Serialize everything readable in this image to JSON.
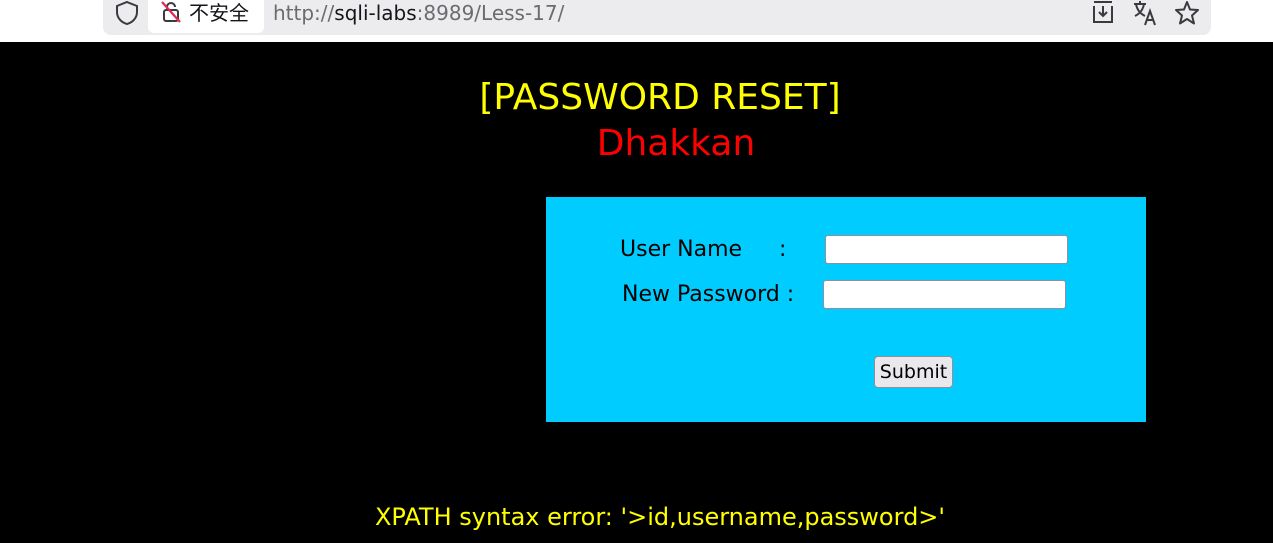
{
  "browser": {
    "security_label": "不安全",
    "url_scheme": "http://",
    "url_host": "sqli-labs",
    "url_rest": ":8989/Less-17/",
    "icons": [
      "shield-icon",
      "insecure-lock-icon",
      "download-icon",
      "translate-icon",
      "bookmark-star-icon"
    ]
  },
  "page": {
    "title": "[PASSWORD RESET]",
    "subtitle": "Dhakkan",
    "form": {
      "username_label": "User Name",
      "username_colon": ":",
      "username_value": "",
      "password_label": "New Password :",
      "password_value": "",
      "submit_label": "Submit"
    },
    "error_message": "XPATH syntax error: '>id,username,password>'"
  },
  "colors": {
    "background": "#000000",
    "title": "#ffff00",
    "subtitle": "#ff0000",
    "form_background": "#00ccff",
    "error": "#ffff00"
  }
}
